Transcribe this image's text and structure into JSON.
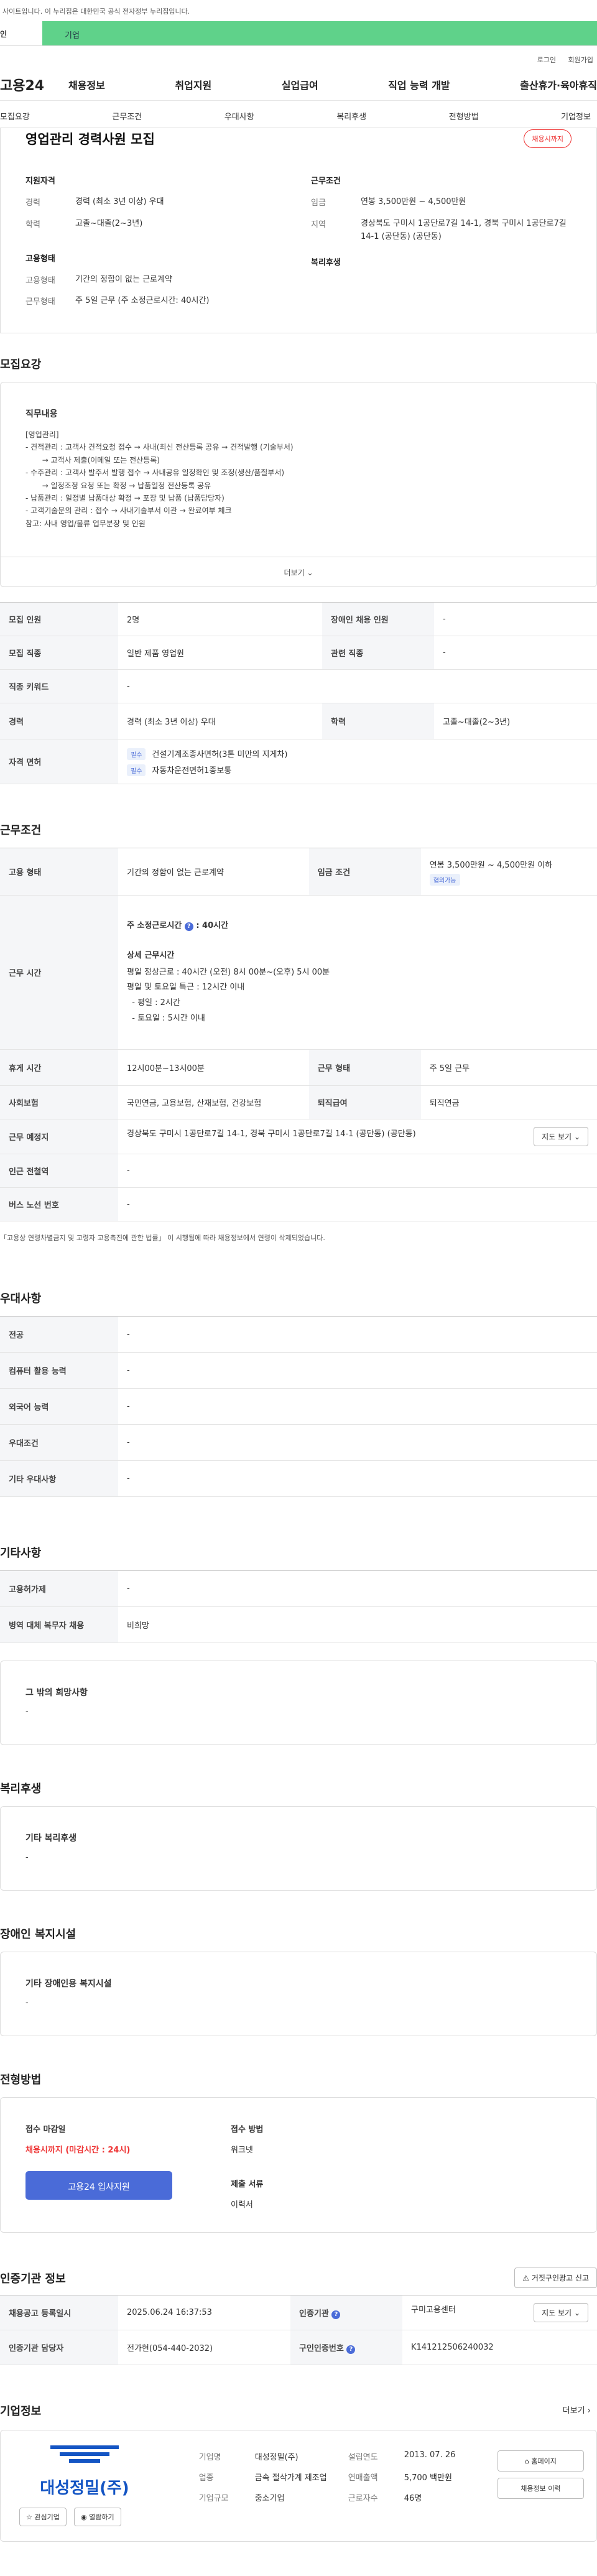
{
  "gov_banner": {
    "text": "사이트입니다. 이 누리집은 대한민국 공식 전자정부 누리집입니다.",
    "left": "인",
    "right": "기업"
  },
  "util": {
    "login": "로그인",
    "join": "회원가입"
  },
  "gnb": {
    "logo": "고용24",
    "menu": [
      "채용정보",
      "취업지원",
      "실업급여",
      "직업 능력 개발",
      "출산휴가·육아휴직"
    ]
  },
  "subnav": [
    "모집요강",
    "근무조건",
    "우대사항",
    "복리후생",
    "전형방법",
    "기업정보"
  ],
  "top": {
    "title": "영업관리 경력사원 모집",
    "status": "채용시까지",
    "qual_h": "지원자격",
    "qual": [
      {
        "k": "경력",
        "v": "경력 (최소 3년 이상) 우대"
      },
      {
        "k": "학력",
        "v": "고졸~대졸(2~3년)"
      }
    ],
    "emp_h": "고용형태",
    "emp": [
      {
        "k": "고용형태",
        "v": "기간의 정함이 없는 근로계약"
      },
      {
        "k": "근무형태",
        "v": "주 5일 근무 (주 소정근로시간: 40시간)"
      }
    ],
    "cond_h": "근무조건",
    "cond": [
      {
        "k": "임금",
        "v": "연봉 3,500만원 ~ 4,500만원"
      },
      {
        "k": "지역",
        "v": "경상북도 구미시 1공단로7길 14-1, 경북 구미시 1공단로7길 14-1 (공단동) (공단동)"
      }
    ],
    "welfare_h": "복리후생"
  },
  "recruit": {
    "heading": "모집요강",
    "duty_h": "직무내용",
    "lines": [
      "[영업관리]",
      "- 견적관리 : 고객사 견적요청 접수 → 사내(최신 전산등록 공유 → 견적발행 (기술부서)",
      "       → 고객사 제출(이메일 또는 전산등록)",
      "- 수주관리 : 고객사 발주서 발행 접수 → 사내공유 일정확인 및 조정(생산/품질부서)",
      "       → 일정조정 요청 또는 확정 → 납품일정 전산등록 공유",
      "- 납품관리 : 일정별 납품대상 확정 → 포장 및 납품 (납품담당자)",
      "- 고객기술문의 관리 : 접수 → 사내기술부서 이관 → 완료여부 체크",
      "",
      "참고: 사내 영업/물류 업무분장 및 인원"
    ],
    "more": "더보기"
  },
  "recruit_table": {
    "count_k": "모집 인원",
    "count_v": "2명",
    "disabled_k": "장애인 채용 인원",
    "disabled_v": "-",
    "job_k": "모집 직종",
    "job_v": "일반 제품 영업원",
    "rel_k": "관련 직종",
    "rel_v": "-",
    "kw_k": "직종 키워드",
    "kw_v": "-",
    "career_k": "경력",
    "career_v": "경력 (최소 3년 이상) 우대",
    "edu_k": "학력",
    "edu_v": "고졸~대졸(2~3년)",
    "lic_k": "자격 면허",
    "lic": [
      {
        "tag": "필수",
        "v": "건설기계조종사면허(3톤 미만의 지게차)"
      },
      {
        "tag": "필수",
        "v": "자동차운전면허1종보통"
      }
    ]
  },
  "work": {
    "heading": "근무조건",
    "emp_k": "고용 형태",
    "emp_v": "기간의 정함이 없는 근로계약",
    "pay_k": "임금 조건",
    "pay_v": "연봉 3,500만원 ~ 4,500만원 이하",
    "pay_tag": "협의가능",
    "hours_k": "근무 시간",
    "hours_title": "주 소정근로시간",
    "hours_value": ": 40시간",
    "hours_detail_h": "상세 근무시간",
    "hours_lines": [
      "평일 정상근로 : 40시간 (오전) 8시 00분~(오후) 5시 00분",
      "평일 및 토요일 특근 : 12시간 이내",
      "  - 평일 : 2시간",
      "  - 토요일 : 5시간 이내"
    ],
    "break_k": "휴게 시간",
    "break_v": "12시00분~13시00분",
    "form_k": "근무 형태",
    "form_v": "주 5일 근무",
    "ins_k": "사회보험",
    "ins_v": "국민연금, 고용보험, 산재보험, 건강보험",
    "sev_k": "퇴직급여",
    "sev_v": "퇴직연금",
    "loc_k": "근무 예정지",
    "loc_v": "경상북도 구미시 1공단로7길 14-1, 경북 구미시 1공단로7길 14-1 (공단동) (공단동)",
    "map_btn": "지도 보기",
    "station_k": "인근 전철역",
    "station_v": "-",
    "bus_k": "버스 노선 번호",
    "bus_v": "-",
    "note": "「고용상 연령차별금지 및 고령자 고용촉진에 관한 법률」 이 시행됨에 따라 채용정보에서 연령이 삭제되었습니다."
  },
  "pref": {
    "heading": "우대사항",
    "rows": [
      {
        "k": "전공",
        "v": "-"
      },
      {
        "k": "컴퓨터 활용 능력",
        "v": "-"
      },
      {
        "k": "외국어 능력",
        "v": "-"
      },
      {
        "k": "우대조건",
        "v": "-"
      },
      {
        "k": "기타 우대사항",
        "v": "-"
      }
    ]
  },
  "etc": {
    "heading": "기타사항",
    "rows": [
      {
        "k": "고용허가제",
        "v": "-"
      },
      {
        "k": "병역 대체 복무자 채용",
        "v": "비희망"
      }
    ],
    "wish_h": "그 밖의 희망사항",
    "wish_v": "-"
  },
  "welfare": {
    "heading": "복리후생",
    "h": "기타 복리후생",
    "v": "-"
  },
  "disabled": {
    "heading": "장애인 복지시설",
    "h": "기타 장애인용 복지시설",
    "v": "-"
  },
  "process": {
    "heading": "전형방법",
    "deadline_h": "접수 마감일",
    "deadline_v": "채용시까지 (마감시간 : 24시)",
    "apply_btn": "고용24 입사지원",
    "method_h": "접수 방법",
    "method_v": "워크넷",
    "doc_h": "제출 서류",
    "doc_v": "이력서"
  },
  "cert": {
    "heading": "인증기관 정보",
    "report_btn": "거짓구인광고 신고",
    "reg_k": "채용공고 등록일시",
    "reg_v": "2025.06.24 16:37:53",
    "org_k": "인증기관",
    "org_v": "구미고용센터",
    "map_btn": "지도 보기",
    "mgr_k": "인증기관 담당자",
    "mgr_v": "전가현(054-440-2032)",
    "num_k": "구인인증번호",
    "num_v": "K141212506240032"
  },
  "company": {
    "heading": "기업정보",
    "more": "더보기",
    "logo_text": "대성정밀(주)",
    "fav_btn": "관심기업",
    "follow_btn": "열람하기",
    "info": [
      {
        "k": "기업명",
        "v": "대성정밀(주)"
      },
      {
        "k": "설립연도",
        "v": "2013. 07. 26"
      },
      {
        "k": "업종",
        "v": "금속 절삭가계 제조업"
      },
      {
        "k": "연매출액",
        "v": "5,700 백만원"
      },
      {
        "k": "기업규모",
        "v": "중소기업"
      },
      {
        "k": "근로자수",
        "v": "46명"
      }
    ],
    "home_btn": "홈페이지",
    "list_btn": "채용정보 이력"
  }
}
